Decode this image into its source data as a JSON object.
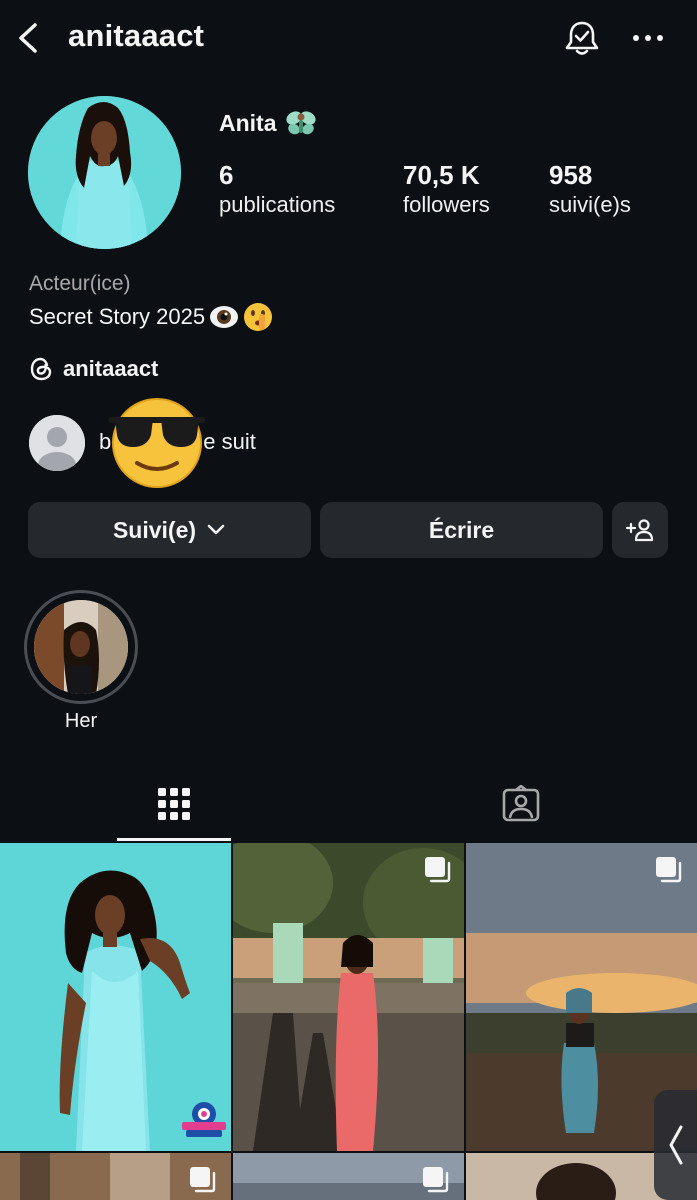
{
  "header": {
    "username": "anitaaact",
    "icons": [
      "back-icon",
      "notification-bell-icon",
      "more-options-icon"
    ]
  },
  "profile": {
    "display_name": "Anita",
    "name_emoji": "fairy-emoji",
    "stats": [
      {
        "value": "6",
        "label": "publications"
      },
      {
        "value": "70,5 K",
        "label": "followers"
      },
      {
        "value": "958",
        "label": "suivi(e)s"
      }
    ],
    "category": "Acteur(ice)",
    "bio": "Secret Story 2025",
    "bio_emojis": [
      "eye-emoji",
      "shushing-face-emoji"
    ],
    "threads_handle": "anitaaact",
    "mutual_prefix": "b",
    "mutual_suffix": "e suit"
  },
  "actions": {
    "following_label": "Suivi(e)",
    "message_label": "Écrire"
  },
  "highlights": [
    {
      "label": "Her"
    }
  ],
  "tabs": [
    "grid-icon",
    "tagged-icon"
  ],
  "grid": {
    "posts": [
      {
        "badge": "SECRET STORY",
        "multi": false
      },
      {
        "multi": true
      },
      {
        "multi": true
      },
      {
        "multi": true
      },
      {
        "multi": true
      },
      {
        "multi": false
      }
    ]
  },
  "colors": {
    "background": "#0c1014",
    "button": "#25292e",
    "secondary_text": "#a8a8a8",
    "text": "#f5f5f5"
  }
}
